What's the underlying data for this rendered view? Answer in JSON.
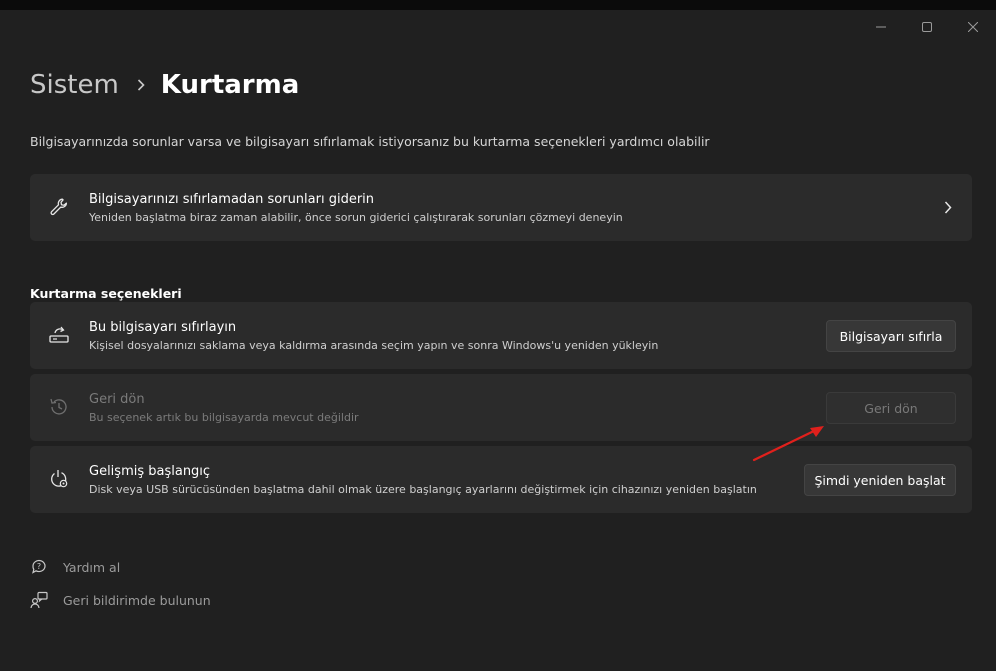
{
  "window": {
    "controls": [
      "minimize-icon",
      "maximize-icon",
      "close-icon"
    ]
  },
  "breadcrumb": {
    "parent": "Sistem",
    "current": "Kurtarma"
  },
  "subtitle": "Bilgisayarınızda sorunlar varsa ve bilgisayarı sıfırlamak istiyorsanız bu kurtarma seçenekleri yardımcı olabilir",
  "troubleshoot": {
    "title": "Bilgisayarınızı sıfırlamadan sorunları giderin",
    "desc": "Yeniden başlatma biraz zaman alabilir, önce sorun giderici çalıştırarak sorunları çözmeyi deneyin",
    "icon": "wrench-icon"
  },
  "section_title": "Kurtarma seçenekleri",
  "options": {
    "reset": {
      "title": "Bu bilgisayarı sıfırlayın",
      "desc": "Kişisel dosyalarınızı saklama veya kaldırma arasında seçim yapın ve sonra Windows'u yeniden yükleyin",
      "button": "Bilgisayarı sıfırla",
      "icon": "reset-pc-icon"
    },
    "goback": {
      "title": "Geri dön",
      "desc": "Bu seçenek artık bu bilgisayarda mevcut değildir",
      "button": "Geri dön",
      "icon": "history-icon",
      "enabled": false
    },
    "advanced": {
      "title": "Gelişmiş başlangıç",
      "desc": "Disk veya USB sürücüsünden başlatma dahil olmak üzere başlangıç ayarlarını değiştirmek için cihazınızı yeniden başlatın",
      "button": "Şimdi yeniden başlat",
      "icon": "advanced-startup-icon"
    }
  },
  "links": {
    "help": "Yardım al",
    "feedback": "Geri bildirimde bulunun"
  },
  "colors": {
    "background": "#202020",
    "card": "#2b2b2b",
    "button": "#373737",
    "annotation_arrow": "#e0201c"
  }
}
